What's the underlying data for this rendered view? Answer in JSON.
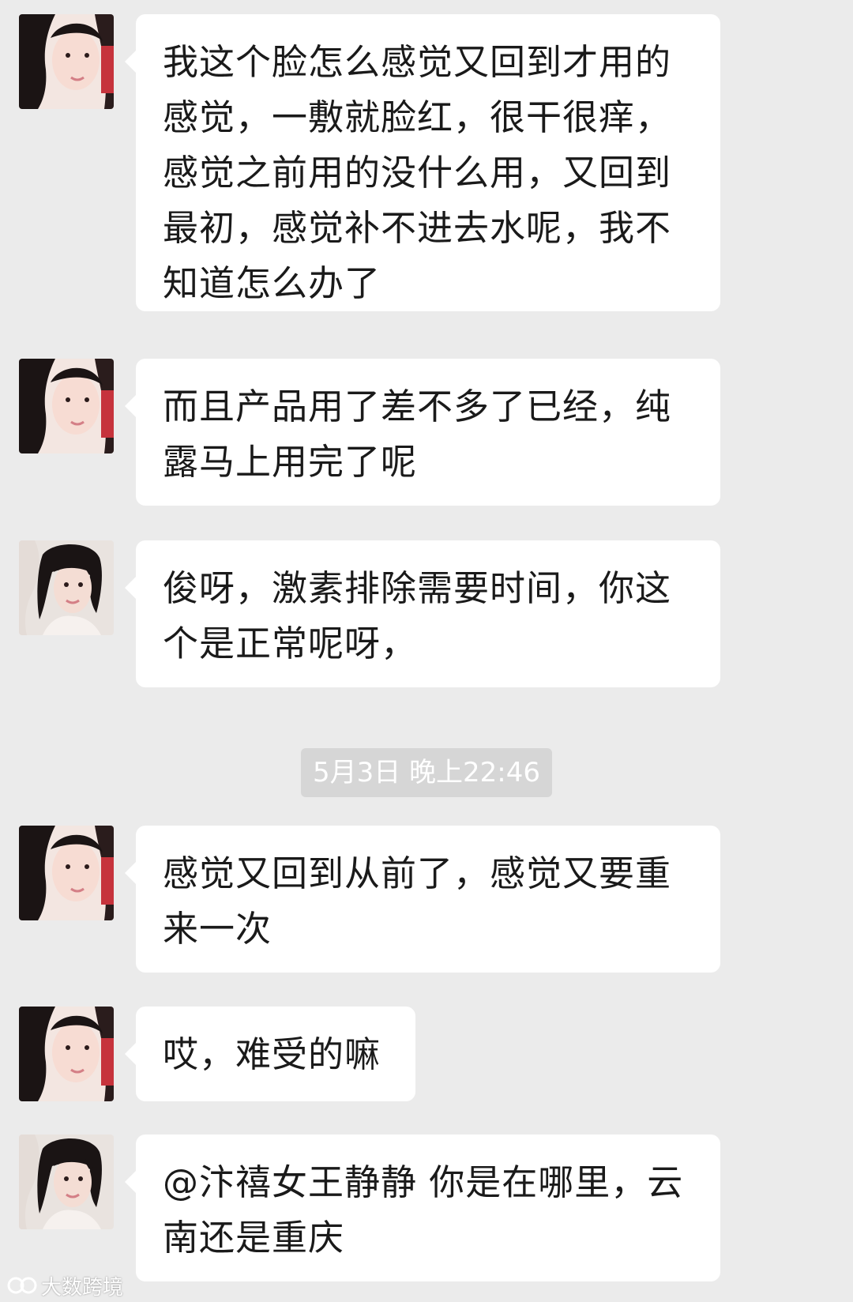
{
  "messages": [
    {
      "sender": "user",
      "text": "我这个脸怎么感觉又回到才用的感觉，一敷就脸红，很干很痒，感觉之前用的没什么用，又回到最初，感觉补不进去水呢，我不知道怎么办了"
    },
    {
      "sender": "user",
      "text": "而且产品用了差不多了已经，纯露马上用完了呢"
    },
    {
      "sender": "consultant",
      "text": "俊呀，激素排除需要时间，你这个是正常呢呀，"
    },
    {
      "sender": "user",
      "text": "感觉又回到从前了，感觉又要重来一次"
    },
    {
      "sender": "user",
      "text": "哎，难受的嘛"
    },
    {
      "sender": "consultant",
      "text": "@汴禧女王静静 你是在哪里，云南还是重庆"
    }
  ],
  "timestamp": "5月3日 晚上22:46",
  "watermark": {
    "text": "大数跨境",
    "logo": "watermark-logo-icon"
  },
  "colors": {
    "background": "#ebebeb",
    "bubble": "#ffffff",
    "timestamp_bg": "#d6d6d6",
    "text": "#1a1a1a"
  }
}
